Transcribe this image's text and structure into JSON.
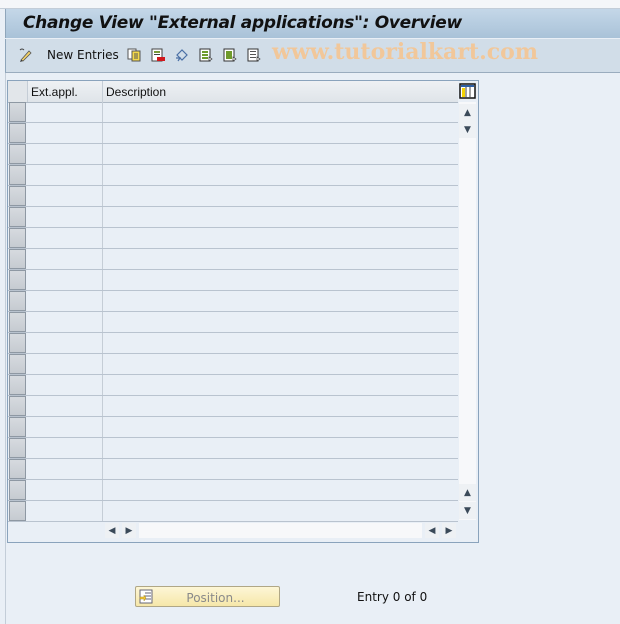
{
  "window": {
    "title": "Change View \"External applications\": Overview"
  },
  "toolbar": {
    "new_entries_label": "New Entries",
    "watermark": "www.tutorialkart.com",
    "icons": [
      "change-display-icon",
      "copy-as-icon",
      "delete-icon",
      "undo-change-icon",
      "select-all-icon",
      "select-block-icon",
      "deselect-all-icon"
    ]
  },
  "table": {
    "columns": [
      {
        "key": "ext_appl",
        "label": "Ext.appl."
      },
      {
        "key": "description",
        "label": "Description"
      }
    ],
    "rows": [
      {
        "ext_appl": "",
        "description": ""
      },
      {
        "ext_appl": "",
        "description": ""
      },
      {
        "ext_appl": "",
        "description": ""
      },
      {
        "ext_appl": "",
        "description": ""
      },
      {
        "ext_appl": "",
        "description": ""
      },
      {
        "ext_appl": "",
        "description": ""
      },
      {
        "ext_appl": "",
        "description": ""
      },
      {
        "ext_appl": "",
        "description": ""
      },
      {
        "ext_appl": "",
        "description": ""
      },
      {
        "ext_appl": "",
        "description": ""
      },
      {
        "ext_appl": "",
        "description": ""
      },
      {
        "ext_appl": "",
        "description": ""
      },
      {
        "ext_appl": "",
        "description": ""
      },
      {
        "ext_appl": "",
        "description": ""
      },
      {
        "ext_appl": "",
        "description": ""
      },
      {
        "ext_appl": "",
        "description": ""
      },
      {
        "ext_appl": "",
        "description": ""
      },
      {
        "ext_appl": "",
        "description": ""
      },
      {
        "ext_appl": "",
        "description": ""
      },
      {
        "ext_appl": "",
        "description": ""
      }
    ]
  },
  "footer": {
    "position_button_label": "Position...",
    "entry_status": "Entry 0 of 0"
  },
  "colors": {
    "title_bar": "#b5cadf",
    "toolbar_bg": "#d1dde8",
    "content_bg": "#e9eff6",
    "position_button": "#f8eebf"
  }
}
